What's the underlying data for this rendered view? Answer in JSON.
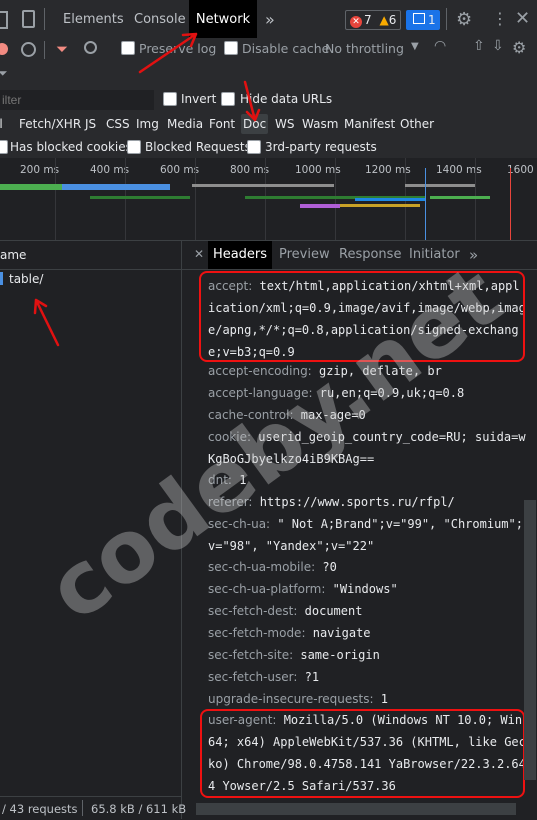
{
  "topbar": {
    "tabs": [
      "Elements",
      "Console",
      "Network"
    ],
    "more": "»",
    "errors": "7",
    "warnings": "6",
    "messages": "1"
  },
  "toolbar": {
    "preserve_log": "Preserve log",
    "disable_cache": "Disable cache",
    "throttling": "No throttling"
  },
  "filter": {
    "placeholder": "ilter",
    "invert": "Invert",
    "hide_data_urls": "Hide data URLs"
  },
  "types": [
    "ll",
    "Fetch/XHR",
    "JS",
    "CSS",
    "Img",
    "Media",
    "Font",
    "Doc",
    "WS",
    "Wasm",
    "Manifest",
    "Other"
  ],
  "blocked": {
    "has_blocked_cookies": "Has blocked cookies",
    "blocked_requests": "Blocked Requests",
    "third_party": "3rd-party requests"
  },
  "timeline": {
    "ticks": [
      "200 ms",
      "400 ms",
      "600 ms",
      "800 ms",
      "1000 ms",
      "1200 ms",
      "1400 ms",
      "1600 r"
    ]
  },
  "requests": {
    "name_header": "ame",
    "items": [
      "table/"
    ]
  },
  "status": {
    "requests": "/ 43 requests",
    "size": "65.8 kB / 611 kB"
  },
  "detail": {
    "tabs": [
      "Headers",
      "Preview",
      "Response",
      "Initiator"
    ],
    "more": "»",
    "headers": [
      {
        "name": "accept:",
        "value": "text/html,application/xhtml+xml,application/xml;q=0.9,image/avif,image/webp,image/apng,*/*;q=0.8,application/signed-exchange;v=b3;q=0.9"
      },
      {
        "name": "accept-encoding:",
        "value": "gzip, deflate, br"
      },
      {
        "name": "accept-language:",
        "value": "ru,en;q=0.9,uk;q=0.8"
      },
      {
        "name": "cache-control:",
        "value": "max-age=0"
      },
      {
        "name": "cookie:",
        "value": "userid_geoip_country_code=RU; suida=wKgBoGJbyelkzo4iB9KBAg=="
      },
      {
        "name": "dnt:",
        "value": "1"
      },
      {
        "name": "referer:",
        "value": "https://www.sports.ru/rfpl/"
      },
      {
        "name": "sec-ch-ua:",
        "value": "\" Not A;Brand\";v=\"99\", \"Chromium\";v=\"98\", \"Yandex\";v=\"22\""
      },
      {
        "name": "sec-ch-ua-mobile:",
        "value": "?0"
      },
      {
        "name": "sec-ch-ua-platform:",
        "value": "\"Windows\""
      },
      {
        "name": "sec-fetch-dest:",
        "value": "document"
      },
      {
        "name": "sec-fetch-mode:",
        "value": "navigate"
      },
      {
        "name": "sec-fetch-site:",
        "value": "same-origin"
      },
      {
        "name": "sec-fetch-user:",
        "value": "?1"
      },
      {
        "name": "upgrade-insecure-requests:",
        "value": "1"
      },
      {
        "name": "user-agent:",
        "value": "Mozilla/5.0 (Windows NT 10.0; Win64; x64) AppleWebKit/537.36 (KHTML, like Gecko) Chrome/98.0.4758.141 YaBrowser/22.3.2.644 Yowser/2.5 Safari/537.36"
      }
    ]
  },
  "watermark": "codeby.net",
  "colors": {
    "accent": "#1a73e8",
    "annotation": "#e11111",
    "background": "#202124"
  }
}
